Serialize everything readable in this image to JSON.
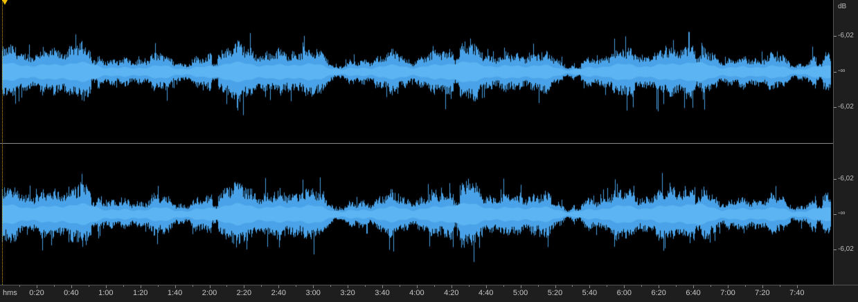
{
  "waveform": {
    "color": "#4aa3e8",
    "playhead_color": "#f0c000",
    "duration_seconds": 485,
    "channels": [
      "ch1",
      "ch2"
    ]
  },
  "db_ruler": {
    "unit": "dB",
    "channel1": {
      "top": "-6,02",
      "center": "-∞",
      "bottom": "-6,02"
    },
    "channel2": {
      "top": "-6,02",
      "center": "-∞",
      "bottom": "-6,02"
    }
  },
  "time_ruler": {
    "format_label": "hms",
    "ticks": [
      "0:20",
      "0:40",
      "1:00",
      "1:20",
      "1:40",
      "2:00",
      "2:20",
      "2:40",
      "3:00",
      "3:20",
      "3:40",
      "4:00",
      "4:20",
      "4:40",
      "5:00",
      "5:20",
      "5:40",
      "6:00",
      "6:20",
      "6:40",
      "7:00",
      "7:20",
      "7:40"
    ]
  }
}
